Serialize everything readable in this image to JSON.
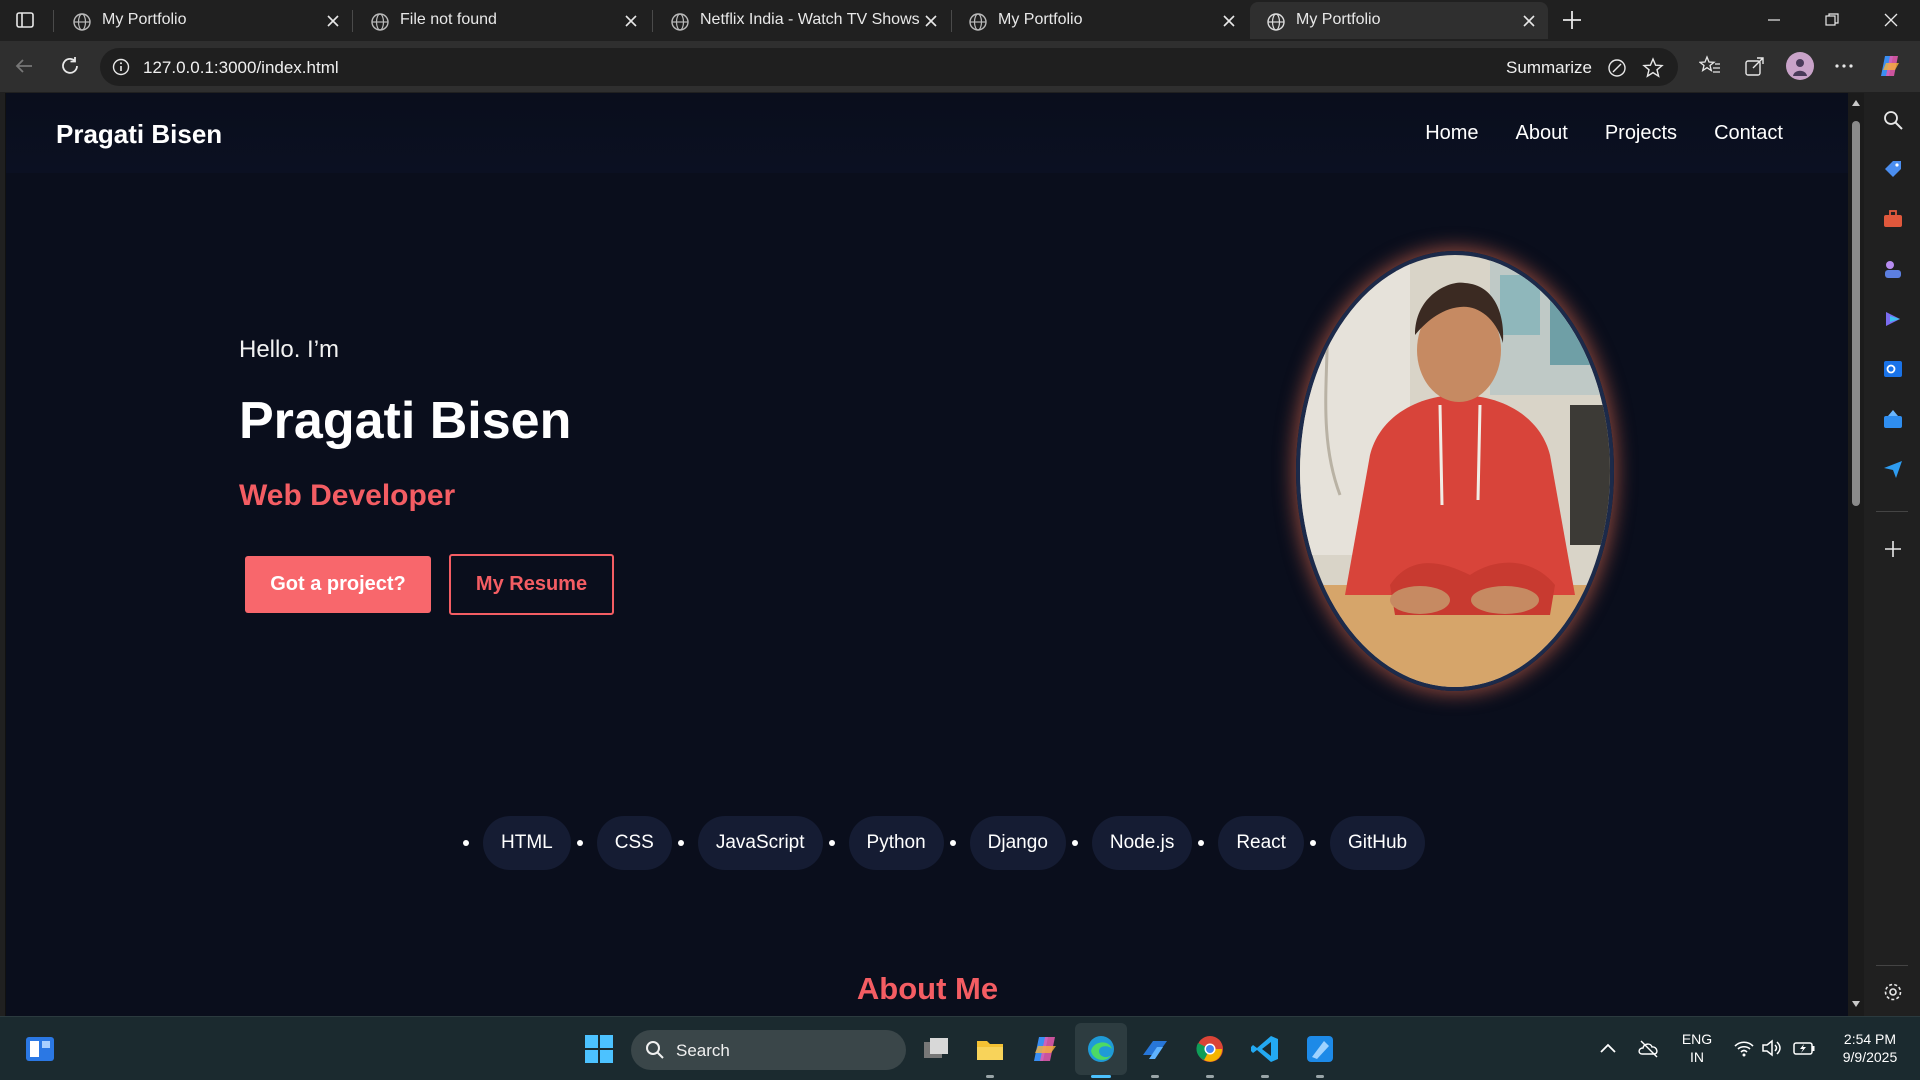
{
  "browser": {
    "tabs": [
      {
        "title": "My Portfolio",
        "active": false
      },
      {
        "title": "File not found",
        "active": false
      },
      {
        "title": "Netflix India - Watch TV Shows Online",
        "active": false
      },
      {
        "title": "My Portfolio",
        "active": false
      },
      {
        "title": "My Portfolio",
        "active": true
      }
    ],
    "url": "127.0.0.1:3000/index.html",
    "summarize_label": "Summarize"
  },
  "site": {
    "brand": "Pragati Bisen",
    "nav": [
      "Home",
      "About",
      "Projects",
      "Contact"
    ],
    "hero": {
      "greeting": "Hello. I’m",
      "name": "Pragati Bisen",
      "role": "Web Developer",
      "primary_button": "Got a project?",
      "secondary_button": "My Resume"
    },
    "skills": [
      "HTML",
      "CSS",
      "JavaScript",
      "Python",
      "Django",
      "Node.js",
      "React",
      "GitHub"
    ],
    "about_title": "About Me",
    "accent_color": "#f45d63"
  },
  "taskbar": {
    "search_label": "Search",
    "language": "ENG",
    "region": "IN",
    "time": "2:54 PM",
    "date": "9/9/2025"
  }
}
